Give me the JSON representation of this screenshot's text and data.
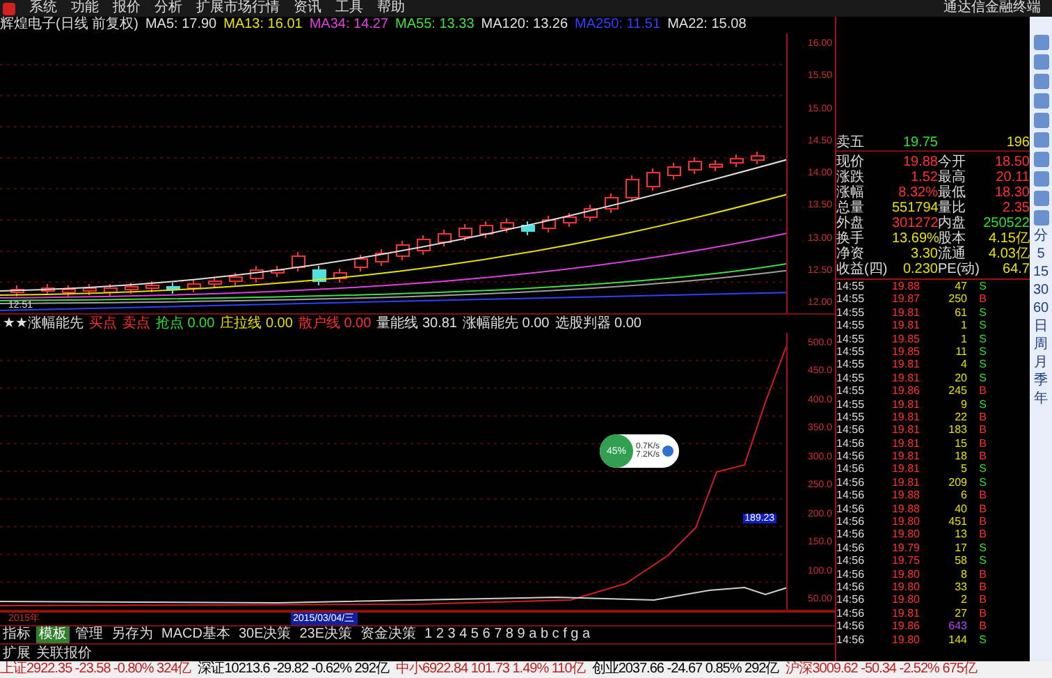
{
  "menu": {
    "items": [
      "系统",
      "功能",
      "报价",
      "分析",
      "扩展市场行情",
      "资讯",
      "工具",
      "帮助"
    ],
    "app_title": "通达信金融终端"
  },
  "main_chart": {
    "title": "辉煌电子(日线 前复权)",
    "ma": [
      {
        "label": "MA5: 17.90",
        "color": "#e0e0e0"
      },
      {
        "label": "MA13: 16.01",
        "color": "#e8e000"
      },
      {
        "label": "MA34: 14.27",
        "color": "#e040e0"
      },
      {
        "label": "MA55: 13.33",
        "color": "#40e040"
      },
      {
        "label": "MA120: 13.26",
        "color": "#e0e0e0"
      },
      {
        "label": "MA250: 11.51",
        "color": "#3040ff"
      },
      {
        "label": "MA22: 15.08",
        "color": "#e0e0e0"
      }
    ],
    "axis": [
      "16.00",
      "15.50",
      "15.00",
      "14.50",
      "14.00",
      "13.50",
      "13.00",
      "12.50",
      "12.00"
    ],
    "low_label": "12.51"
  },
  "indicator": {
    "title": "★★涨幅能先",
    "items": [
      {
        "label": "买点",
        "value": "",
        "color": "#ff3030"
      },
      {
        "label": "卖点",
        "value": "",
        "color": "#ff3030"
      },
      {
        "label": "抢点",
        "value": "0.00",
        "color": "#30e030"
      },
      {
        "label": "庄拉线",
        "value": "0.00",
        "color": "#e8e000"
      },
      {
        "label": "散户线",
        "value": "0.00",
        "color": "#ff3030"
      },
      {
        "label": "量能线",
        "value": "30.81",
        "color": "#e0e0e0"
      },
      {
        "label": "涨幅能先",
        "value": "0.00",
        "color": "#e0e0e0"
      },
      {
        "label": "选股判器",
        "value": "0.00",
        "color": "#e0e0e0"
      }
    ],
    "axis": [
      "500.0",
      "450.0",
      "400.0",
      "350.0",
      "300.0",
      "250.0",
      "200.0",
      "150.0",
      "100.0",
      "50.00"
    ],
    "cursor_value": "189.23"
  },
  "date_axis": {
    "year": "2015年",
    "cursor_date": "2015/03/04/三"
  },
  "bottom_tabs": [
    {
      "label": "指标",
      "selected": false
    },
    {
      "label": "模板",
      "selected": true
    },
    {
      "label": "管理",
      "selected": false
    },
    {
      "label": "另存为",
      "selected": false
    },
    {
      "label": "MACD基本",
      "selected": false
    },
    {
      "label": "30E决策",
      "selected": false
    },
    {
      "label": "23E决策",
      "selected": false
    },
    {
      "label": "资金决策",
      "selected": false
    },
    {
      "label": "1 2 3 4 5 6 7 8 9 a b c f g a",
      "selected": false
    }
  ],
  "extra_tabs": [
    "扩展",
    "关联报价"
  ],
  "quote": {
    "partial": {
      "label": "卖五",
      "value": "19.75",
      "volume": "196"
    },
    "rows": [
      {
        "cells": [
          {
            "label": "现价",
            "value": "19.88",
            "color": "#ff3030"
          },
          {
            "label": "今开",
            "value": "18.50",
            "color": "#ff3030"
          }
        ]
      },
      {
        "cells": [
          {
            "label": "涨跌",
            "value": "1.52",
            "color": "#ff3030"
          },
          {
            "label": "最高",
            "value": "20.11",
            "color": "#ff3030"
          }
        ]
      },
      {
        "cells": [
          {
            "label": "涨幅",
            "value": "8.32%",
            "color": "#ff3030"
          },
          {
            "label": "最低",
            "value": "18.30",
            "color": "#ff3030"
          }
        ]
      },
      {
        "cells": [
          {
            "label": "总量",
            "value": "551794",
            "color": "#e8e000"
          },
          {
            "label": "量比",
            "value": "2.35",
            "color": "#ff3030"
          }
        ]
      },
      {
        "cells": [
          {
            "label": "外盘",
            "value": "301272",
            "color": "#ff3030"
          },
          {
            "label": "内盘",
            "value": "250522",
            "color": "#30e030"
          }
        ]
      },
      {
        "cells": [
          {
            "label": "换手",
            "value": "13.69%",
            "color": "#e8e000"
          },
          {
            "label": "股本",
            "value": "4.15亿",
            "color": "#e8e000"
          }
        ]
      },
      {
        "cells": [
          {
            "label": "净资",
            "value": "3.30",
            "color": "#e8e000"
          },
          {
            "label": "流通",
            "value": "4.03亿",
            "color": "#e8e000"
          }
        ]
      },
      {
        "cells": [
          {
            "label": "收益(四)",
            "value": "0.230",
            "color": "#e8e000"
          },
          {
            "label": "PE(动)",
            "value": "64.7",
            "color": "#e8e000"
          }
        ]
      }
    ]
  },
  "ticks": [
    {
      "time": "14:55",
      "price": "19.88",
      "volume": "47",
      "side": "S",
      "large": false
    },
    {
      "time": "14:55",
      "price": "19.87",
      "volume": "250",
      "side": "B",
      "large": false
    },
    {
      "time": "14:55",
      "price": "19.81",
      "volume": "61",
      "side": "S",
      "large": false
    },
    {
      "time": "14:55",
      "price": "19.81",
      "volume": "1",
      "side": "S",
      "large": false
    },
    {
      "time": "14:55",
      "price": "19.85",
      "volume": "1",
      "side": "S",
      "large": false
    },
    {
      "time": "14:55",
      "price": "19.85",
      "volume": "11",
      "side": "S",
      "large": false
    },
    {
      "time": "14:55",
      "price": "19.81",
      "volume": "4",
      "side": "S",
      "large": false
    },
    {
      "time": "14:55",
      "price": "19.81",
      "volume": "20",
      "side": "S",
      "large": false
    },
    {
      "time": "14:55",
      "price": "19.86",
      "volume": "245",
      "side": "B",
      "large": false
    },
    {
      "time": "14:55",
      "price": "19.81",
      "volume": "9",
      "side": "S",
      "large": false
    },
    {
      "time": "14:55",
      "price": "19.81",
      "volume": "22",
      "side": "B",
      "large": false
    },
    {
      "time": "14:56",
      "price": "19.81",
      "volume": "183",
      "side": "B",
      "large": false
    },
    {
      "time": "14:56",
      "price": "19.81",
      "volume": "15",
      "side": "B",
      "large": false
    },
    {
      "time": "14:56",
      "price": "19.81",
      "volume": "18",
      "side": "B",
      "large": false
    },
    {
      "time": "14:56",
      "price": "19.81",
      "volume": "5",
      "side": "S",
      "large": false
    },
    {
      "time": "14:56",
      "price": "19.81",
      "volume": "209",
      "side": "S",
      "large": false
    },
    {
      "time": "14:56",
      "price": "19.88",
      "volume": "6",
      "side": "B",
      "large": false
    },
    {
      "time": "14:56",
      "price": "19.88",
      "volume": "40",
      "side": "B",
      "large": false
    },
    {
      "time": "14:56",
      "price": "19.80",
      "volume": "451",
      "side": "B",
      "large": false
    },
    {
      "time": "14:56",
      "price": "19.80",
      "volume": "13",
      "side": "B",
      "large": false
    },
    {
      "time": "14:56",
      "price": "19.79",
      "volume": "17",
      "side": "S",
      "large": false
    },
    {
      "time": "14:56",
      "price": "19.75",
      "volume": "58",
      "side": "S",
      "large": false
    },
    {
      "time": "14:56",
      "price": "19.80",
      "volume": "8",
      "side": "B",
      "large": false
    },
    {
      "time": "14:56",
      "price": "19.80",
      "volume": "33",
      "side": "B",
      "large": false
    },
    {
      "time": "14:56",
      "price": "19.80",
      "volume": "2",
      "side": "B",
      "large": false
    },
    {
      "time": "14:56",
      "price": "19.81",
      "volume": "27",
      "side": "B",
      "large": false
    },
    {
      "time": "14:56",
      "price": "19.86",
      "volume": "643",
      "side": "B",
      "large": true
    },
    {
      "time": "14:56",
      "price": "19.80",
      "volume": "144",
      "side": "S",
      "large": false
    }
  ],
  "speed_widget": {
    "percent": "45%",
    "up": "0.7K/s",
    "down": "7.2K/s"
  },
  "side_toolbar": [
    {
      "kind": "icon"
    },
    {
      "kind": "icon"
    },
    {
      "kind": "icon"
    },
    {
      "kind": "icon"
    },
    {
      "kind": "icon"
    },
    {
      "kind": "icon"
    },
    {
      "kind": "icon"
    },
    {
      "kind": "icon"
    },
    {
      "kind": "icon"
    },
    {
      "kind": "icon"
    },
    {
      "kind": "text",
      "label": "分"
    },
    {
      "kind": "text",
      "label": "5"
    },
    {
      "kind": "text",
      "label": "15"
    },
    {
      "kind": "text",
      "label": "30"
    },
    {
      "kind": "text",
      "label": "60"
    },
    {
      "kind": "text",
      "label": "日"
    },
    {
      "kind": "text",
      "label": "周"
    },
    {
      "kind": "text",
      "label": "月"
    },
    {
      "kind": "text",
      "label": "季"
    },
    {
      "kind": "text",
      "label": "年"
    }
  ],
  "status_bar": [
    "上证2922.35 -23.58 -0.80% 324亿",
    "深证10213.6 -29.82 -0.62% 292亿",
    "中小6922.84 101.73 1.49% 110亿",
    "创业2037.66 -24.67 0.85% 292亿",
    "沪深3009.62 -50.34 -2.52% 675亿"
  ]
}
